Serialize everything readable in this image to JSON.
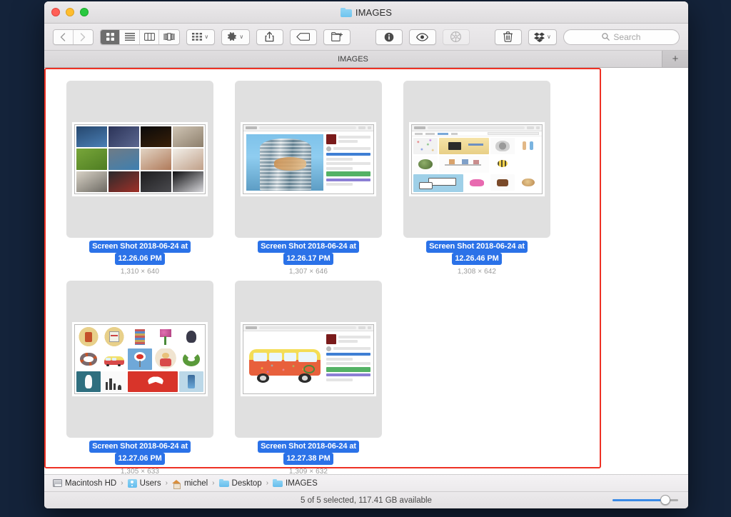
{
  "window": {
    "title": "IMAGES",
    "title_icon": "folder-icon",
    "traffic_lights": [
      "close-button",
      "minimize-button",
      "zoom-button"
    ]
  },
  "toolbar": {
    "back_label": "‹",
    "forward_label": "›",
    "view_buttons": [
      {
        "name": "icon-view",
        "active": true
      },
      {
        "name": "list-view",
        "active": false
      },
      {
        "name": "column-view",
        "active": false
      },
      {
        "name": "coverflow-view",
        "active": false
      }
    ],
    "arrange_label": "arrange-icon",
    "action_label": "gear-icon",
    "share_label": "share-icon",
    "tag_label": "tag-icon",
    "newfolder_label": "new-folder-icon",
    "info_label": "info-icon",
    "quicklook_label": "eye-icon",
    "burn_label": "burn-icon",
    "delete_label": "trash-icon",
    "dropbox_label": "dropbox-icon",
    "chevron": "∨"
  },
  "search": {
    "placeholder": "Search",
    "value": "",
    "icon": "search-icon"
  },
  "tabbar": {
    "active_tab": "IMAGES",
    "new_tab_label": "+"
  },
  "files": [
    {
      "name_line1": "Screen Shot 2018-06-24 at",
      "name_line2": "12.26.06 PM",
      "dimensions": "1,310 × 640",
      "selected": true,
      "thumb": "photo-grid"
    },
    {
      "name_line1": "Screen Shot 2018-06-24 at",
      "name_line2": "12.26.17 PM",
      "dimensions": "1,307 × 646",
      "selected": true,
      "thumb": "web-building"
    },
    {
      "name_line1": "Screen Shot 2018-06-24 at",
      "name_line2": "12.26.46 PM",
      "dimensions": "1,308 × 642",
      "selected": true,
      "thumb": "illustration-search"
    },
    {
      "name_line1": "Screen Shot 2018-06-24 at",
      "name_line2": "12.27.06 PM",
      "dimensions": "1,305 × 633",
      "selected": true,
      "thumb": "illustration-grid"
    },
    {
      "name_line1": "Screen Shot 2018-06-24 at",
      "name_line2": "12.27.38 PM",
      "dimensions": "1,309 × 632",
      "selected": true,
      "thumb": "web-bus"
    }
  ],
  "pathbar": {
    "crumbs": [
      {
        "label": "Macintosh HD",
        "icon": "harddisk-icon"
      },
      {
        "label": "Users",
        "icon": "users-folder-icon"
      },
      {
        "label": "michel",
        "icon": "home-icon"
      },
      {
        "label": "Desktop",
        "icon": "folder-icon"
      },
      {
        "label": "IMAGES",
        "icon": "folder-icon"
      }
    ],
    "separator": "›"
  },
  "statusbar": {
    "text": "5 of 5 selected, 117.41 GB available",
    "zoom_percent": 80
  },
  "annotation": {
    "color": "#ee3124"
  },
  "colors": {
    "selection_blue": "#2b72e8",
    "accent_blue": "#3a8ae6",
    "annotation_red": "#ee3124",
    "window_chrome": "#eceaec",
    "desktop": "#14233a"
  }
}
